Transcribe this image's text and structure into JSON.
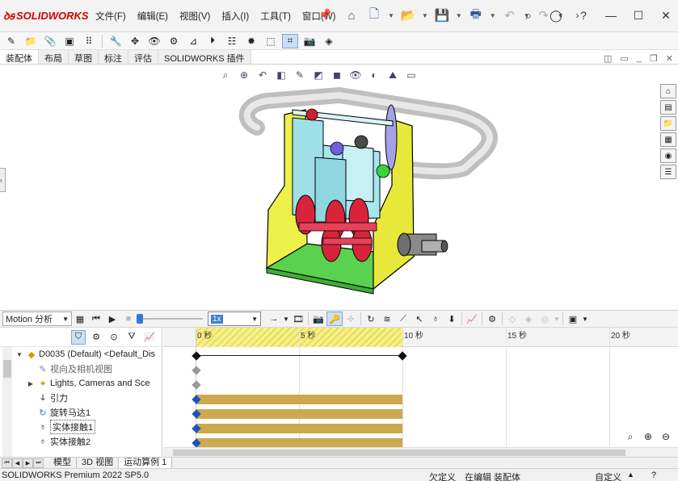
{
  "app": {
    "brand": "SOLIDWORKS",
    "menu": [
      "文件(F)",
      "编辑(E)",
      "视图(V)",
      "插入(I)",
      "工具(T)",
      "窗口(W)"
    ]
  },
  "command_tabs": [
    "装配体",
    "布局",
    "草图",
    "标注",
    "评估",
    "SOLIDWORKS 插件"
  ],
  "motion": {
    "study_type": "Motion 分析",
    "speed": "1x",
    "timeline_ticks": [
      "0 秒",
      "5 秒",
      "10 秒",
      "15 秒",
      "20 秒"
    ],
    "tree": [
      {
        "label": "D0035 (Default) <Default_Dis",
        "icon": "assembly-icon",
        "expand": "▼"
      },
      {
        "label": "视向及相机视图",
        "icon": "camera-view-icon",
        "expand": ""
      },
      {
        "label": "Lights, Cameras and Sce",
        "icon": "lights-icon",
        "expand": "▶"
      },
      {
        "label": "引力",
        "icon": "gravity-icon",
        "expand": ""
      },
      {
        "label": "旋转马达1",
        "icon": "motor-icon",
        "expand": ""
      },
      {
        "label": "实体接触1",
        "icon": "contact-icon",
        "expand": ""
      },
      {
        "label": "实体接触2",
        "icon": "contact-icon",
        "expand": ""
      }
    ]
  },
  "bottom_tabs": [
    "模型",
    "3D 视图",
    "运动算例 1"
  ],
  "status": {
    "version": "SOLIDWORKS Premium 2022 SP5.0",
    "definition": "欠定义",
    "editing": "在编辑 装配体",
    "units": "自定义"
  },
  "colors": {
    "brand": "#d40000",
    "timeline_bar": "#cda94e",
    "selection_blue": "#2e7bd3"
  }
}
